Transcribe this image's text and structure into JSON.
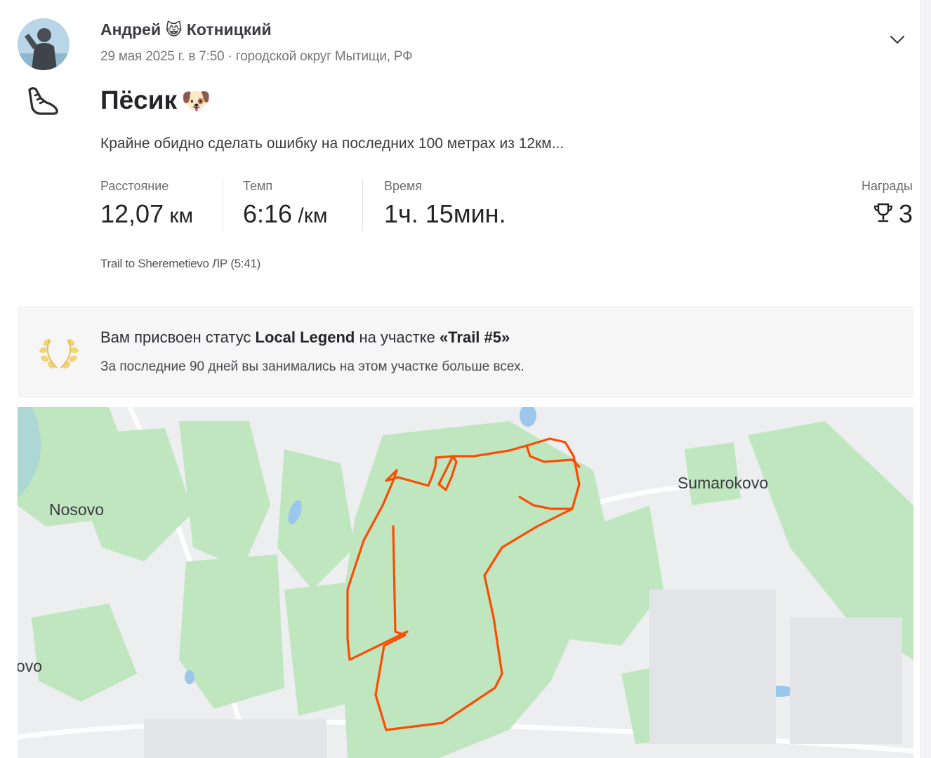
{
  "post": {
    "author": "Андрей 😸 Котницкий",
    "datetime": "29 мая 2025 г. в 7:50",
    "location": "городской округ Мытищи, РФ",
    "meta_sep": " · ",
    "activity_icon": "running-shoe-icon",
    "title": "Пёсик",
    "title_emoji": "🐶",
    "description": "Крайне обидно сделать ошибку на последних 100 метрах из 12км..."
  },
  "stats": {
    "distance": {
      "label": "Расстояние",
      "value": "12,07",
      "unit": " км"
    },
    "pace": {
      "label": "Темп",
      "value": "6:16",
      "unit": " /км"
    },
    "time": {
      "label": "Время",
      "value": "1ч. 15мин."
    },
    "awards": {
      "label": "Награды",
      "value": "3",
      "icon": "trophy-icon"
    }
  },
  "segment_record": "Trail to Sheremetievo ЛР (5:41)",
  "local_legend": {
    "icon": "laurel-icon",
    "title_prefix": "Вам присвоен статус ",
    "title_status": "Local Legend",
    "title_middle": " на участке ",
    "title_segment": "«Trail #5»",
    "subtitle": "За последние 90 дней вы занимались на этом участке больше всех."
  },
  "map": {
    "labels": {
      "nosovo": "Nosovo",
      "sumarokovo": "Sumarokovo",
      "partial": "ovo"
    },
    "route_color": "#fc4c02",
    "park_color": "#bfe6bf"
  }
}
